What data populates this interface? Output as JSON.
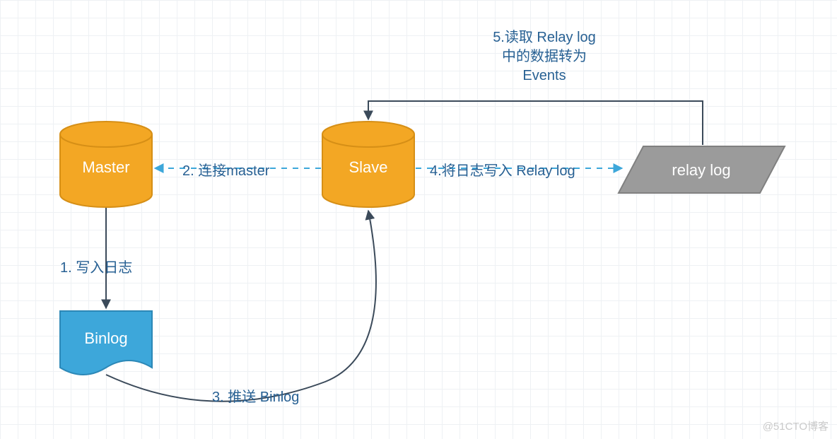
{
  "nodes": {
    "master": {
      "label": "Master"
    },
    "slave": {
      "label": "Slave"
    },
    "binlog": {
      "label": "Binlog"
    },
    "relay_log": {
      "label": "relay log"
    }
  },
  "edges": {
    "e1": {
      "label": "1. 写入日志"
    },
    "e2": {
      "label": "2. 连接master"
    },
    "e3": {
      "label": "3. 推送 Binlog"
    },
    "e4": {
      "label": "4.将日志写入 Relay log"
    },
    "e5": {
      "line1": "5.读取 Relay log",
      "line2": "中的数据转为",
      "line3": "Events"
    }
  },
  "watermark": "@51CTO博客",
  "colors": {
    "cylinder_fill": "#f3a724",
    "cylinder_stroke": "#d68f16",
    "doc_fill": "#3da7da",
    "doc_stroke": "#2c88b7",
    "parallelogram_fill": "#9b9b9b",
    "parallelogram_stroke": "#808080",
    "edge_text": "#276093",
    "solid_line": "#3b4a5a",
    "dashed_line": "#3da7da"
  }
}
